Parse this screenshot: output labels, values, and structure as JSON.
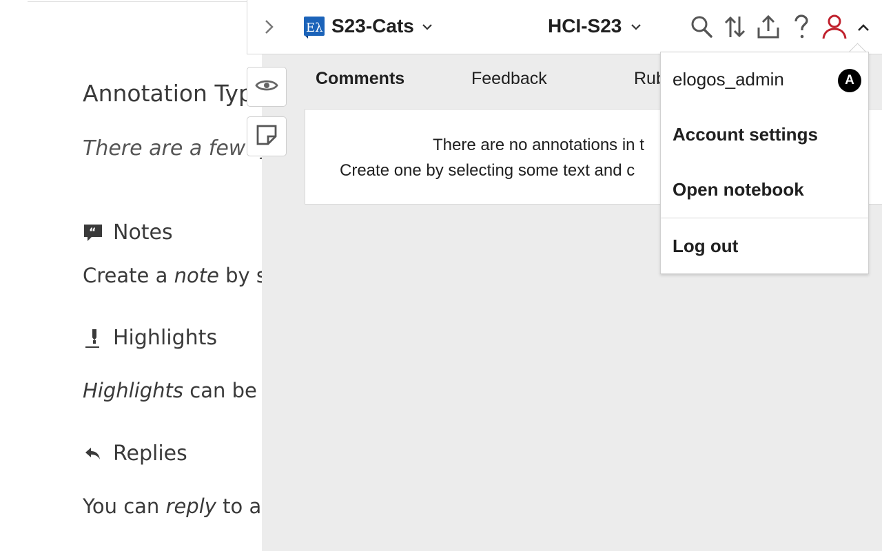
{
  "document": {
    "heading": "Annotation Typ",
    "lead": "There are a few ty",
    "sections": [
      {
        "icon": "quote-icon",
        "title": "Notes",
        "para_pre": "Create a ",
        "para_em": "note",
        "para_post": " by se"
      },
      {
        "icon": "highlighter-icon",
        "title": "Highlights",
        "para_pre": "",
        "para_em": "Highlights",
        "para_post": " can be cr"
      },
      {
        "icon": "reply-icon",
        "title": "Replies",
        "para_pre": "You can ",
        "para_em": "reply",
        "para_post": " to any"
      }
    ]
  },
  "topbar": {
    "group_name": "S23-Cats",
    "course_name": "HCI-S23",
    "icons": [
      "search-icon",
      "sort-icon",
      "share-icon",
      "help-icon",
      "user-icon",
      "chevron-up-icon"
    ]
  },
  "tabs": [
    {
      "label": "Comments",
      "active": true
    },
    {
      "label": "Feedback",
      "active": false
    },
    {
      "label": "Rub",
      "active": false
    }
  ],
  "empty_state": {
    "line1": "There are no annotations in t",
    "line2": "Create one by selecting some text and c"
  },
  "user_menu": {
    "username": "elogos_admin",
    "badge": "A",
    "items": [
      "Account settings",
      "Open notebook"
    ],
    "logout": "Log out"
  },
  "colors": {
    "accent_user": "#c0212d",
    "logo_blue": "#1b63b9",
    "sidebar_bg": "#ececec"
  }
}
